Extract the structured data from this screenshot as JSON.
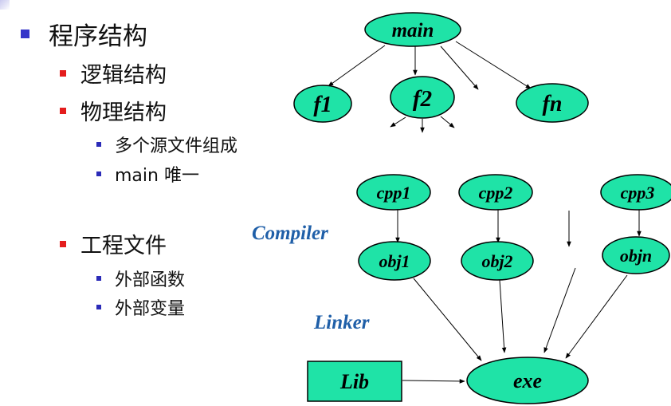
{
  "bullets": {
    "program_structure": "程序结构",
    "logical_structure": "逻辑结构",
    "physical_structure": "物理结构",
    "multi_source": "多个源文件组成",
    "main_unique": "main 唯一",
    "project_file": "工程文件",
    "external_function": "外部函数",
    "external_variable": "外部变量"
  },
  "diagram": {
    "main": "main",
    "f1": "f1",
    "f2": "f2",
    "fn": "fn",
    "cpp1": "cpp1",
    "cpp2": "cpp2",
    "cpp3": "cpp3",
    "obj1": "obj1",
    "obj2": "obj2",
    "objn": "objn",
    "compiler": "Compiler",
    "linker": "Linker",
    "lib": "Lib",
    "exe": "exe"
  },
  "colors": {
    "node_fill": "#1fe3a7",
    "label_blue": "#1f5fa8",
    "bullet_l1": "#3535c9",
    "bullet_l2": "#e41d1d"
  }
}
